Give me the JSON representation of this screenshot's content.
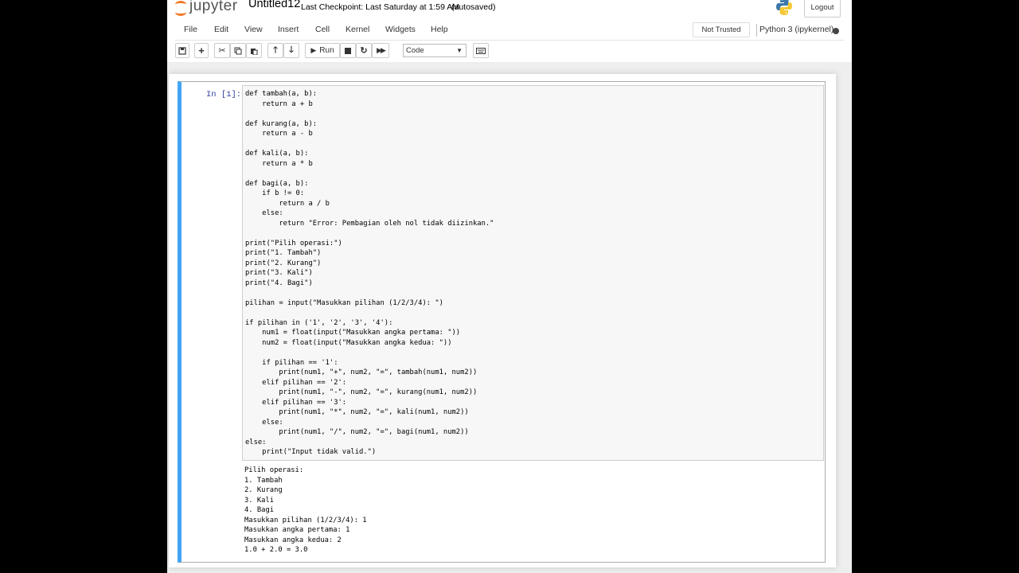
{
  "header": {
    "logo_text": "jupyter",
    "notebook_name": "Untitled12",
    "checkpoint": "Last Checkpoint: Last Saturday at 1:59 AM",
    "autosave": "(autosaved)",
    "logout_label": "Logout"
  },
  "menubar": {
    "items": [
      "File",
      "Edit",
      "View",
      "Insert",
      "Cell",
      "Kernel",
      "Widgets",
      "Help"
    ],
    "trust_label": "Not Trusted",
    "kernel_name": "Python 3 (ipykernel)"
  },
  "toolbar": {
    "run_label": "Run",
    "cell_type": "Code",
    "icons": [
      "save-icon",
      "plus-icon",
      "cut-icon",
      "copy-icon",
      "paste-icon",
      "arrow-up-icon",
      "arrow-down-icon",
      "run-icon",
      "stop-icon",
      "restart-icon",
      "fast-forward-icon",
      "keyboard-icon"
    ]
  },
  "cell": {
    "prompt": "In [1]:",
    "code": "def tambah(a, b):\n    return a + b\n\ndef kurang(a, b):\n    return a - b\n\ndef kali(a, b):\n    return a * b\n\ndef bagi(a, b):\n    if b != 0:\n        return a / b\n    else:\n        return \"Error: Pembagian oleh nol tidak diizinkan.\"\n\nprint(\"Pilih operasi:\")\nprint(\"1. Tambah\")\nprint(\"2. Kurang\")\nprint(\"3. Kali\")\nprint(\"4. Bagi\")\n\npilihan = input(\"Masukkan pilihan (1/2/3/4): \")\n\nif pilihan in ('1', '2', '3', '4'):\n    num1 = float(input(\"Masukkan angka pertama: \"))\n    num2 = float(input(\"Masukkan angka kedua: \"))\n\n    if pilihan == '1':\n        print(num1, \"+\", num2, \"=\", tambah(num1, num2))\n    elif pilihan == '2':\n        print(num1, \"-\", num2, \"=\", kurang(num1, num2))\n    elif pilihan == '3':\n        print(num1, \"*\", num2, \"=\", kali(num1, num2))\n    else:\n        print(num1, \"/\", num2, \"=\", bagi(num1, num2))\nelse:\n    print(\"Input tidak valid.\")",
    "output": "Pilih operasi:\n1. Tambah\n2. Kurang\n3. Kali\n4. Bagi\nMasukkan pilihan (1/2/3/4): 1\nMasukkan angka pertama: 1\nMasukkan angka kedua: 2\n1.0 + 2.0 = 3.0"
  },
  "colors": {
    "accent": "#42a5f5",
    "prompt": "#303f9f",
    "logo": "#f37726"
  }
}
